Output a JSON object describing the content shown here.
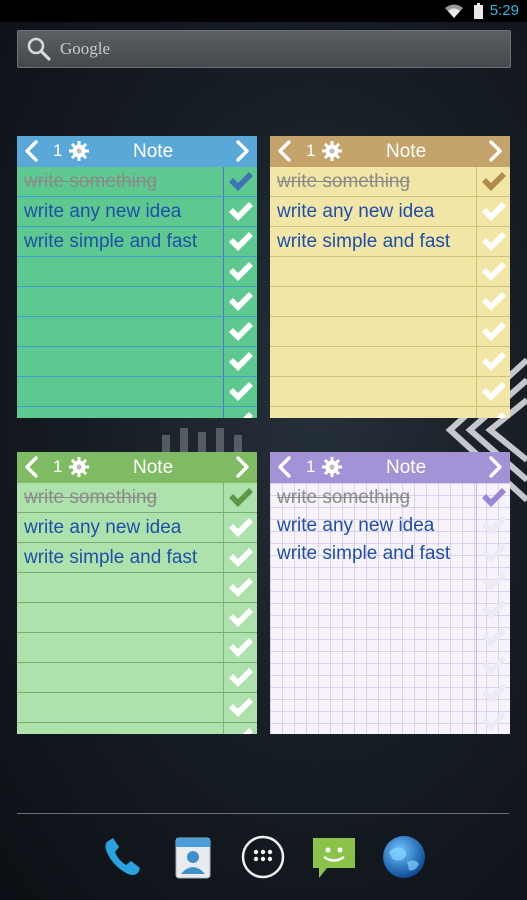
{
  "status_bar": {
    "time": "5:29"
  },
  "search": {
    "label": "Google"
  },
  "widgets": [
    {
      "page": "1",
      "title": "Note",
      "header_color": "#5aa8d8",
      "items": [
        {
          "text": "write something",
          "done": true
        },
        {
          "text": "write any new idea",
          "done": false
        },
        {
          "text": "write simple and fast",
          "done": false
        }
      ]
    },
    {
      "page": "1",
      "title": "Note",
      "header_color": "#c4a46a",
      "items": [
        {
          "text": "write something",
          "done": true
        },
        {
          "text": "write any new idea",
          "done": false
        },
        {
          "text": "write simple and fast",
          "done": false
        }
      ]
    },
    {
      "page": "1",
      "title": "Note",
      "header_color": "#7fbb62",
      "items": [
        {
          "text": "write something",
          "done": true
        },
        {
          "text": "write any new idea",
          "done": false
        },
        {
          "text": "write simple and fast",
          "done": false
        }
      ]
    },
    {
      "page": "1",
      "title": "Note",
      "header_color": "#a393d6",
      "items": [
        {
          "text": "write something",
          "done": true
        },
        {
          "text": "write any new idea",
          "done": false
        },
        {
          "text": "write simple and fast",
          "done": false
        }
      ]
    }
  ],
  "dock": {
    "icons": [
      "phone-icon",
      "contacts-icon",
      "app-drawer-icon",
      "messaging-icon",
      "browser-icon"
    ]
  }
}
